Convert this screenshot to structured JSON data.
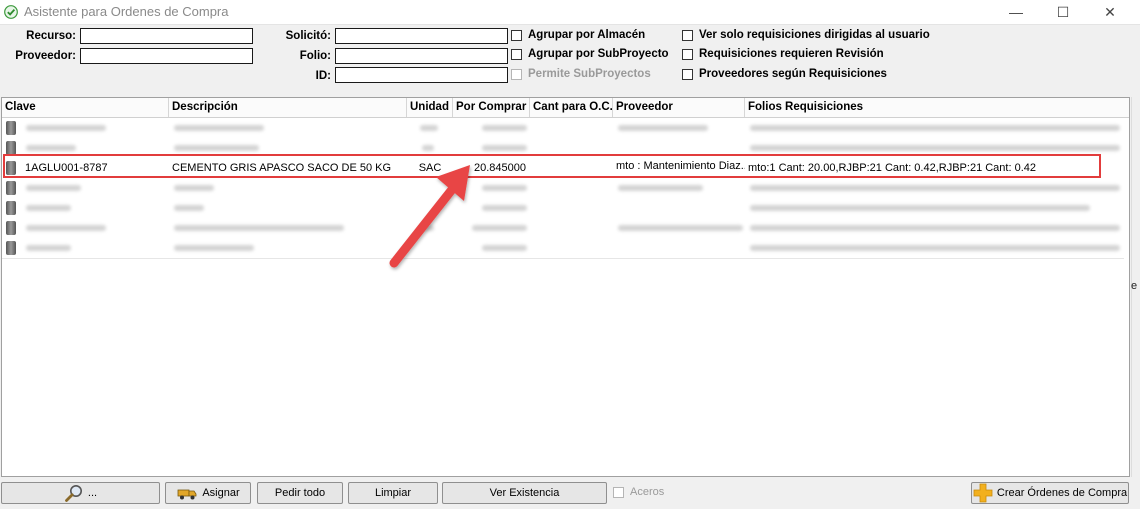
{
  "window": {
    "title": "Asistente para Ordenes de Compra",
    "min": "—",
    "max": "☐",
    "close": "✕"
  },
  "form": {
    "recurso_label": "Recurso:",
    "recurso_value": "",
    "proveedor_label": "Proveedor:",
    "proveedor_value": "",
    "solicito_label": "Solicitó:",
    "solicito_value": "",
    "folio_label": "Folio:",
    "folio_value": "",
    "id_label": "ID:",
    "id_value": "",
    "checks": [
      {
        "label": "Agrupar por Almacén",
        "checked": false,
        "enabled": true
      },
      {
        "label": "Agrupar por SubProyecto",
        "checked": false,
        "enabled": true
      },
      {
        "label": "Permite SubProyectos",
        "checked": false,
        "enabled": false
      },
      {
        "label": "Ver solo requisiciones dirigidas al usuario",
        "checked": false,
        "enabled": true
      },
      {
        "label": "Requisiciones requieren Revisión",
        "checked": false,
        "enabled": true
      },
      {
        "label": "Proveedores según Requisiciones",
        "checked": false,
        "enabled": true
      }
    ]
  },
  "grid": {
    "columns": [
      "Clave",
      "Descripción",
      "Unidad",
      "Por Comprar",
      "Cant para O.C.",
      "Proveedor",
      "Folios Requisiciones"
    ],
    "highlighted_row": {
      "clave": "1AGLU001-8787",
      "descripcion": "CEMENTO GRIS APASCO SACO DE 50 KG",
      "unidad": "SAC",
      "por_comprar": "20.845000",
      "cant_oc": "",
      "proveedor": "mto : Mantenimiento Diaz...",
      "folios": "mto:1 Cant: 20.00,RJBP:21 Cant: 0.42,RJBP:21 Cant: 0.42"
    },
    "side_mark": "e"
  },
  "buttons": {
    "search": "...",
    "asignar": "Asignar",
    "pedir_todo": "Pedir todo",
    "limpiar": "Limpiar",
    "ver_existencia": "Ver Existencia",
    "aceros": "Aceros",
    "crear": "Crear Órdenes de Compra"
  },
  "colors": {
    "highlight": "#e23c3c",
    "arrow": "#e84545",
    "plus_icon": "#f2b01e"
  }
}
